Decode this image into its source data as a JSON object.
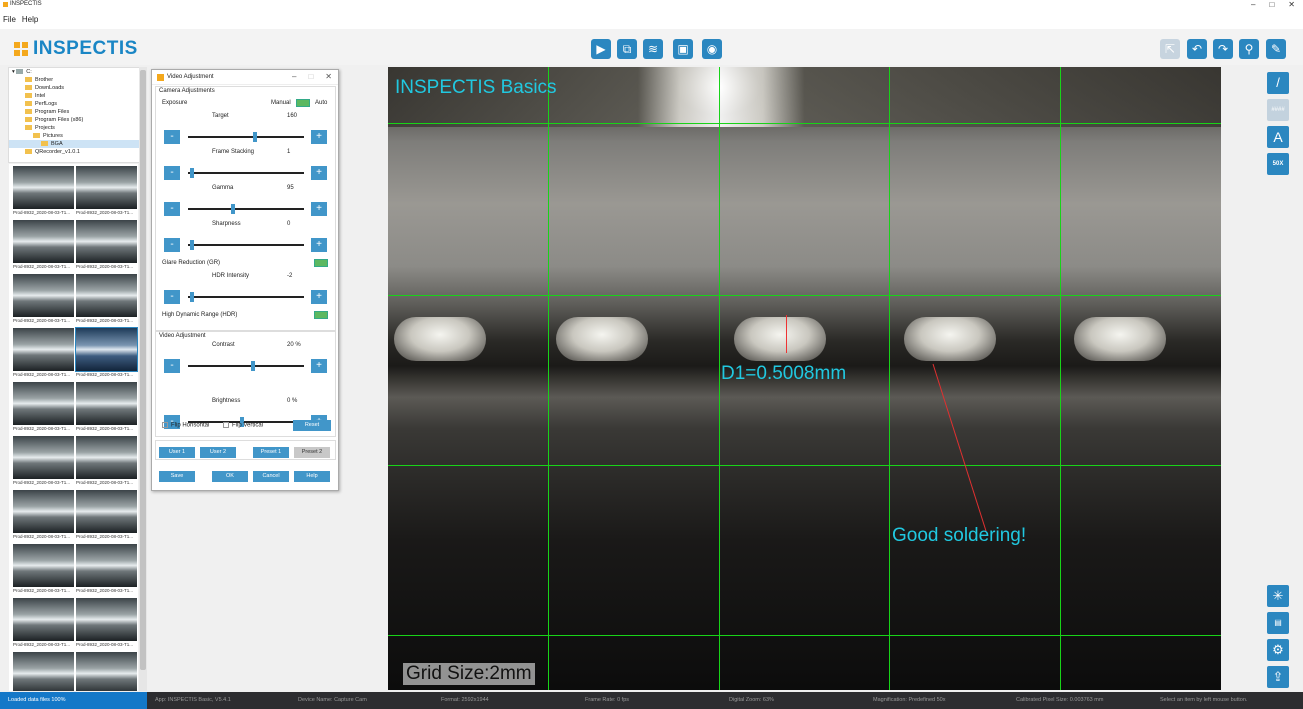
{
  "app": {
    "title": "INSPECTIS",
    "logo_text": "INSPECTIS",
    "window_controls": [
      "–",
      "□",
      "✕"
    ]
  },
  "menu": [
    "File",
    "Help"
  ],
  "toolbar": {
    "center": [
      "play-icon",
      "capture-series-icon",
      "stack-icon",
      "save-icon",
      "camera-icon"
    ],
    "right": [
      "select-icon",
      "undo-icon",
      "redo-icon",
      "zoom-icon",
      "eraser-icon"
    ]
  },
  "right_tools": {
    "line": "/",
    "grid": "####",
    "text": "A",
    "magnification": "50X"
  },
  "tree": {
    "root": "C:",
    "items": [
      "Brother",
      "DownLoads",
      "Intel",
      "PerfLogs",
      "Program Files",
      "Program Files (x86)",
      "Projects",
      "Pictures",
      "BGA",
      "QRecorder_v1.0.1"
    ]
  },
  "thumb_caption_a": "Prod-8932_2020-08-03-T1...",
  "thumb_caption_b": "Prod-8932_2020-08-03-T1...",
  "dialog": {
    "title": "Video Adjustment",
    "controls": [
      "–",
      "□",
      "✕"
    ],
    "camera_section": "Camera Adjustments",
    "exposure": "Exposure",
    "manual": "Manual",
    "auto": "Auto",
    "target_label": "Target",
    "target_value": "160",
    "target_level": 0.58,
    "frame_label": "Frame Stacking",
    "frame_value": "1",
    "frame_level": 0.02,
    "gamma_label": "Gamma",
    "gamma_value": "95",
    "gamma_level": 0.38,
    "sharp_label": "Sharpness",
    "sharp_value": "0",
    "sharp_level": 0.02,
    "glare_label": "Glare Reduction (GR)",
    "hdr_label": "HDR Intensity",
    "hdr_value": "-2",
    "hdr_level": 0.02,
    "hdr_toggle_label": "High Dynamic Range (HDR)",
    "video_section": "Video Adjustment",
    "contrast_label": "Contrast",
    "contrast_value": "20 %",
    "contrast_level": 0.56,
    "bright_label": "Brightness",
    "bright_value": "0 %",
    "bright_level": 0.46,
    "flip_h": "Flip Horisontal",
    "flip_v": "Flip Vertical",
    "reset": "Reset",
    "user1": "User 1",
    "user2": "User 2",
    "preset1": "Preset 1",
    "preset2": "Preset 2",
    "save": "Save",
    "ok": "OK",
    "cancel": "Cancel",
    "help": "Help",
    "minus": "-",
    "plus": "+"
  },
  "view": {
    "title": "INSPECTIS Basics",
    "measure": "D1=0.5008mm",
    "annotation": "Good soldering!",
    "grid_size": "Grid Size:2mm"
  },
  "status": {
    "loaded": "Loaded data files 100%",
    "app": "App: INSPECTIS Basic, V5.4.1",
    "device": "Device Name: Capture Cam",
    "format": "Format: 2592x1944",
    "frame_rate": "Frame Rate: 0 fps",
    "zoom": "Digital Zoom: 63%",
    "magnification": "Magnification: Predefined 50x",
    "pixel": "Calibrated Pixel Size: 0.003763 mm",
    "hint": "Select an item by left mouse button."
  },
  "colors": {
    "accent": "#2b87c0",
    "grid": "#18d318",
    "overlay_text": "#21c8e0",
    "logo_mark": "#f4a81c"
  }
}
